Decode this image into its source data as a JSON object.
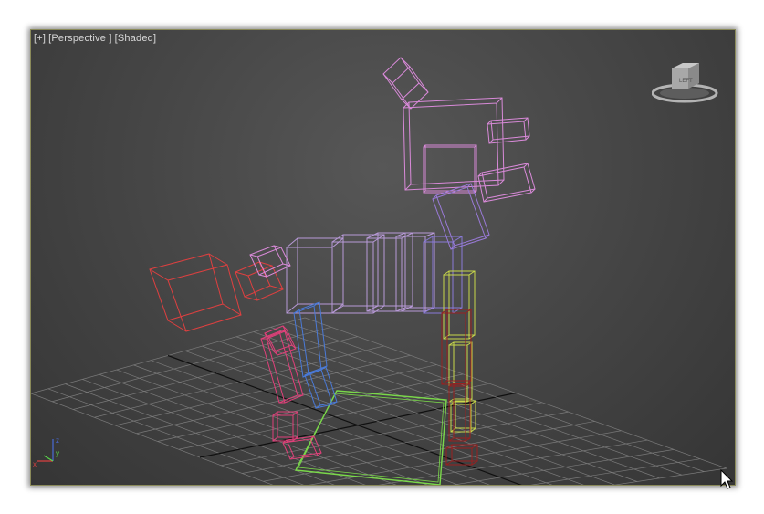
{
  "viewport": {
    "labels": {
      "plus": "[+]",
      "view": "[Perspective ]",
      "shading": "[Shaded]"
    },
    "viewcube": {
      "face": "LEFT"
    },
    "axis": {
      "x": "x",
      "y": "y",
      "z": "z"
    }
  },
  "colors": {
    "grid": "#7a7a7a",
    "grid_axis": "#101010",
    "head": "#d98ad9",
    "neck": "#9a7ad8",
    "spine": "#b89ad8",
    "pelvis": "#8a7ad8",
    "tail": "#e04040",
    "back_leg_left": "#e0407a",
    "back_leg_right": "#4a7ad8",
    "front_leg_left": "#c8d84a",
    "front_leg_right": "#9a2020",
    "ground_rect": "#7ad84a"
  },
  "icons": {
    "viewcube": "viewcube-icon",
    "axis_tripod": "axis-tripod-icon",
    "cursor": "mouse-pointer-icon"
  }
}
